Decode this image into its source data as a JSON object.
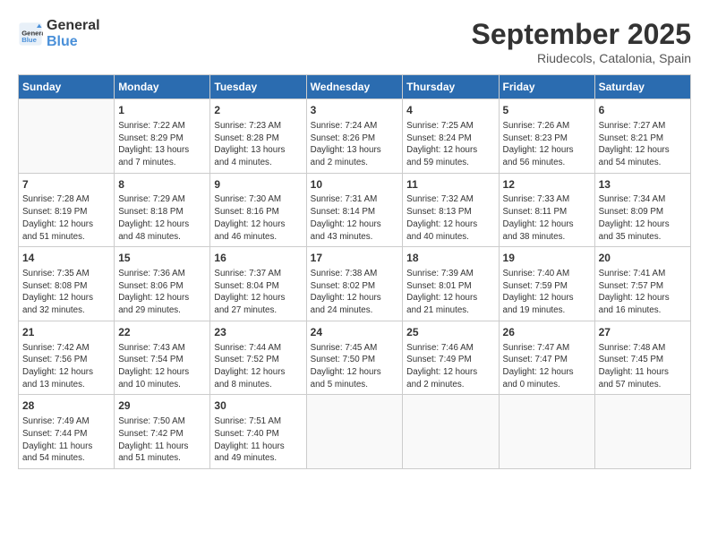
{
  "logo": {
    "line1": "General",
    "line2": "Blue"
  },
  "title": "September 2025",
  "subtitle": "Riudecols, Catalonia, Spain",
  "weekdays": [
    "Sunday",
    "Monday",
    "Tuesday",
    "Wednesday",
    "Thursday",
    "Friday",
    "Saturday"
  ],
  "weeks": [
    [
      {
        "day": "",
        "info": ""
      },
      {
        "day": "1",
        "info": "Sunrise: 7:22 AM\nSunset: 8:29 PM\nDaylight: 13 hours\nand 7 minutes."
      },
      {
        "day": "2",
        "info": "Sunrise: 7:23 AM\nSunset: 8:28 PM\nDaylight: 13 hours\nand 4 minutes."
      },
      {
        "day": "3",
        "info": "Sunrise: 7:24 AM\nSunset: 8:26 PM\nDaylight: 13 hours\nand 2 minutes."
      },
      {
        "day": "4",
        "info": "Sunrise: 7:25 AM\nSunset: 8:24 PM\nDaylight: 12 hours\nand 59 minutes."
      },
      {
        "day": "5",
        "info": "Sunrise: 7:26 AM\nSunset: 8:23 PM\nDaylight: 12 hours\nand 56 minutes."
      },
      {
        "day": "6",
        "info": "Sunrise: 7:27 AM\nSunset: 8:21 PM\nDaylight: 12 hours\nand 54 minutes."
      }
    ],
    [
      {
        "day": "7",
        "info": "Sunrise: 7:28 AM\nSunset: 8:19 PM\nDaylight: 12 hours\nand 51 minutes."
      },
      {
        "day": "8",
        "info": "Sunrise: 7:29 AM\nSunset: 8:18 PM\nDaylight: 12 hours\nand 48 minutes."
      },
      {
        "day": "9",
        "info": "Sunrise: 7:30 AM\nSunset: 8:16 PM\nDaylight: 12 hours\nand 46 minutes."
      },
      {
        "day": "10",
        "info": "Sunrise: 7:31 AM\nSunset: 8:14 PM\nDaylight: 12 hours\nand 43 minutes."
      },
      {
        "day": "11",
        "info": "Sunrise: 7:32 AM\nSunset: 8:13 PM\nDaylight: 12 hours\nand 40 minutes."
      },
      {
        "day": "12",
        "info": "Sunrise: 7:33 AM\nSunset: 8:11 PM\nDaylight: 12 hours\nand 38 minutes."
      },
      {
        "day": "13",
        "info": "Sunrise: 7:34 AM\nSunset: 8:09 PM\nDaylight: 12 hours\nand 35 minutes."
      }
    ],
    [
      {
        "day": "14",
        "info": "Sunrise: 7:35 AM\nSunset: 8:08 PM\nDaylight: 12 hours\nand 32 minutes."
      },
      {
        "day": "15",
        "info": "Sunrise: 7:36 AM\nSunset: 8:06 PM\nDaylight: 12 hours\nand 29 minutes."
      },
      {
        "day": "16",
        "info": "Sunrise: 7:37 AM\nSunset: 8:04 PM\nDaylight: 12 hours\nand 27 minutes."
      },
      {
        "day": "17",
        "info": "Sunrise: 7:38 AM\nSunset: 8:02 PM\nDaylight: 12 hours\nand 24 minutes."
      },
      {
        "day": "18",
        "info": "Sunrise: 7:39 AM\nSunset: 8:01 PM\nDaylight: 12 hours\nand 21 minutes."
      },
      {
        "day": "19",
        "info": "Sunrise: 7:40 AM\nSunset: 7:59 PM\nDaylight: 12 hours\nand 19 minutes."
      },
      {
        "day": "20",
        "info": "Sunrise: 7:41 AM\nSunset: 7:57 PM\nDaylight: 12 hours\nand 16 minutes."
      }
    ],
    [
      {
        "day": "21",
        "info": "Sunrise: 7:42 AM\nSunset: 7:56 PM\nDaylight: 12 hours\nand 13 minutes."
      },
      {
        "day": "22",
        "info": "Sunrise: 7:43 AM\nSunset: 7:54 PM\nDaylight: 12 hours\nand 10 minutes."
      },
      {
        "day": "23",
        "info": "Sunrise: 7:44 AM\nSunset: 7:52 PM\nDaylight: 12 hours\nand 8 minutes."
      },
      {
        "day": "24",
        "info": "Sunrise: 7:45 AM\nSunset: 7:50 PM\nDaylight: 12 hours\nand 5 minutes."
      },
      {
        "day": "25",
        "info": "Sunrise: 7:46 AM\nSunset: 7:49 PM\nDaylight: 12 hours\nand 2 minutes."
      },
      {
        "day": "26",
        "info": "Sunrise: 7:47 AM\nSunset: 7:47 PM\nDaylight: 12 hours\nand 0 minutes."
      },
      {
        "day": "27",
        "info": "Sunrise: 7:48 AM\nSunset: 7:45 PM\nDaylight: 11 hours\nand 57 minutes."
      }
    ],
    [
      {
        "day": "28",
        "info": "Sunrise: 7:49 AM\nSunset: 7:44 PM\nDaylight: 11 hours\nand 54 minutes."
      },
      {
        "day": "29",
        "info": "Sunrise: 7:50 AM\nSunset: 7:42 PM\nDaylight: 11 hours\nand 51 minutes."
      },
      {
        "day": "30",
        "info": "Sunrise: 7:51 AM\nSunset: 7:40 PM\nDaylight: 11 hours\nand 49 minutes."
      },
      {
        "day": "",
        "info": ""
      },
      {
        "day": "",
        "info": ""
      },
      {
        "day": "",
        "info": ""
      },
      {
        "day": "",
        "info": ""
      }
    ]
  ]
}
